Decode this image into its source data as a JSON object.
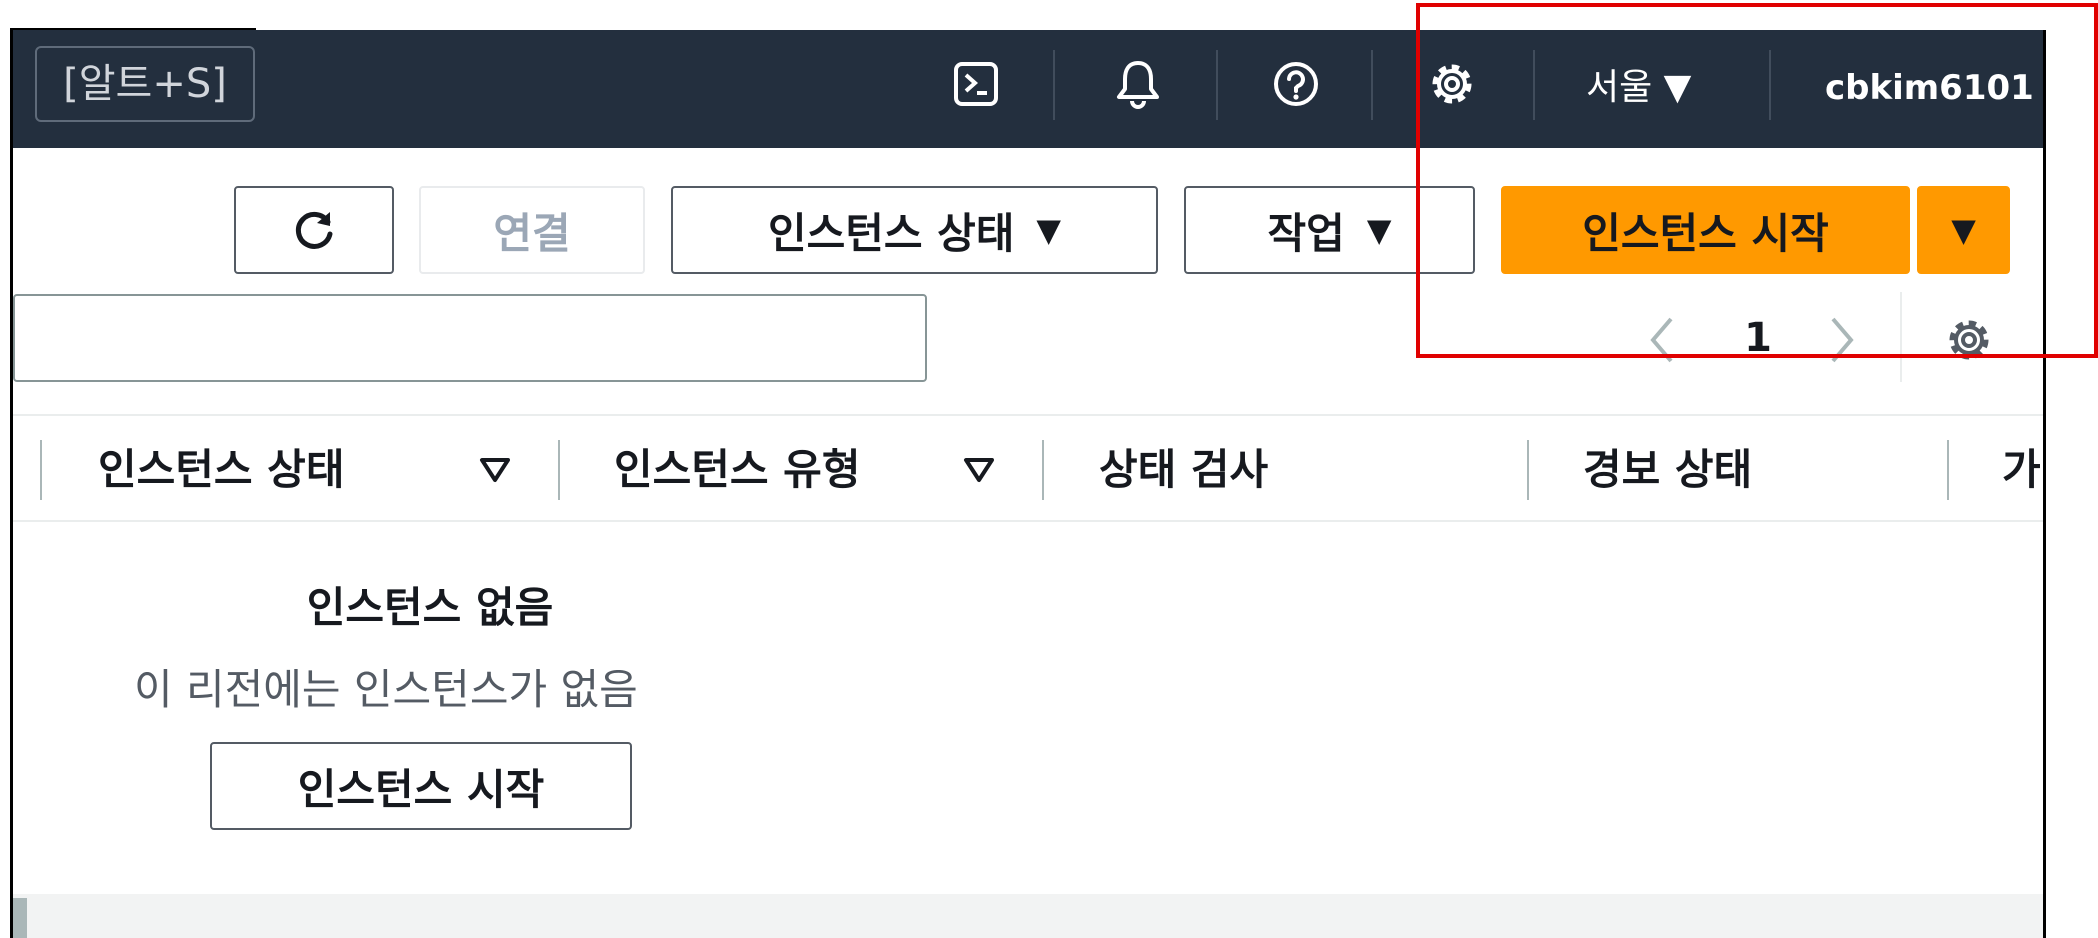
{
  "topnav": {
    "search_shortcut": "[알트+S]",
    "region": "서울 ▼",
    "user": "cbkim6101"
  },
  "toolbar": {
    "refresh_icon": "refresh-icon",
    "connect_label": "연결",
    "instance_state_label": "인스턴스 상태",
    "actions_label": "작업",
    "launch_label": "인스턴스 시작",
    "caret": "▼"
  },
  "pagination": {
    "current_page": "1"
  },
  "table": {
    "columns": [
      "인스턴스 상태",
      "인스턴스 유형",
      "상태 검사",
      "경보 상태",
      "가"
    ]
  },
  "empty_state": {
    "title": "인스턴스 없음",
    "description": "이 리전에는 인스턴스가 없음",
    "button_label": "인스턴스 시작"
  },
  "colors": {
    "nav_bg": "#232f3e",
    "primary": "#ff9900",
    "highlight": "#e00000"
  }
}
